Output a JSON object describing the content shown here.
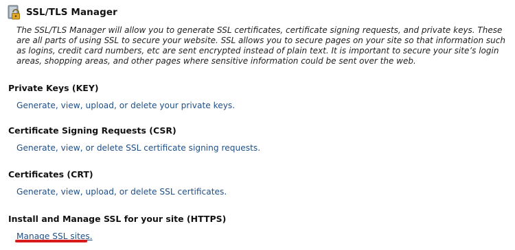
{
  "header": {
    "title": "SSL/TLS Manager",
    "icon": "lock-icon"
  },
  "description": "The SSL/TLS Manager will allow you to generate SSL certificates, certificate signing requests, and private keys. These are all parts of using SSL to secure your website. SSL allows you to secure pages on your site so that information such as logins, credit card numbers, etc are sent encrypted instead of plain text. It is important to secure your site’s login areas, shopping areas, and other pages where sensitive information could be sent over the web.",
  "sections": [
    {
      "heading": "Private Keys (KEY)",
      "link": "Generate, view, upload, or delete your private keys."
    },
    {
      "heading": "Certificate Signing Requests (CSR)",
      "link": "Generate, view, or delete SSL certificate signing requests."
    },
    {
      "heading": "Certificates (CRT)",
      "link": "Generate, view, upload, or delete SSL certificates."
    },
    {
      "heading": "Install and Manage SSL for your site (HTTPS)",
      "link": "Manage SSL sites."
    }
  ],
  "colors": {
    "link": "#1f4f87",
    "highlight": "#d81c1c"
  }
}
